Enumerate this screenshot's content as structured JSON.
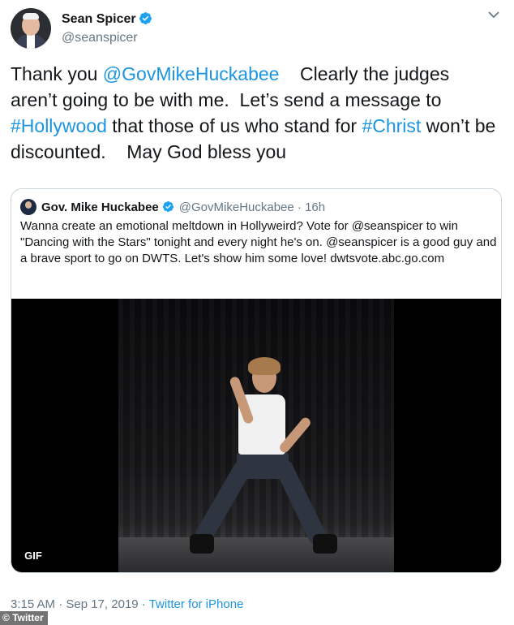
{
  "author": {
    "display_name": "Sean Spicer",
    "handle": "@seanspicer",
    "verified": true
  },
  "tweet": {
    "text_segments": [
      {
        "text": "Thank you ",
        "type": "text"
      },
      {
        "text": "@GovMikeHuckabee",
        "type": "mention"
      },
      {
        "text": "    Clearly the judges aren’t going to be with me.  Let’s send a message to ",
        "type": "text"
      },
      {
        "text": "#Hollywood",
        "type": "hashtag"
      },
      {
        "text": " that those of us who stand for ",
        "type": "text"
      },
      {
        "text": "#Christ",
        "type": "hashtag"
      },
      {
        "text": " won’t be discounted.    May God bless you",
        "type": "text"
      }
    ]
  },
  "quoted_tweet": {
    "display_name": "Gov. Mike Huckabee",
    "handle": "@GovMikeHuckabee",
    "separator": "·",
    "time": "16h",
    "verified": true,
    "text": "Wanna create an emotional meltdown in Hollyweird?  Vote for @seanspicer to win \"Dancing with the Stars\" tonight and every night he's on.  @seanspicer is a good guy and a brave sport to go on DWTS.  Let's show him some love! dwtsvote.abc.go.com",
    "media": {
      "badge": "GIF"
    }
  },
  "footer": {
    "time": "3:15 AM",
    "separator1": " · ",
    "date": "Sep 17, 2019",
    "separator2": " · ",
    "source": "Twitter for iPhone"
  },
  "watermark": "Twitter",
  "colors": {
    "link": "#1b95e0",
    "verified": "#1da1f2",
    "text": "#14171a",
    "muted": "#657786",
    "border": "#ccd6dd"
  },
  "icons": [
    "verified-badge-icon",
    "chevron-down-icon",
    "gif-badge"
  ]
}
